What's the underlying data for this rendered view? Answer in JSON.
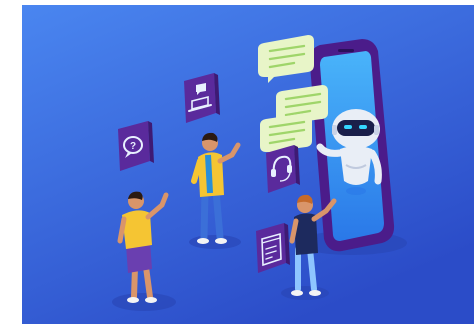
{
  "scene": {
    "kind": "isometric chatbot illustration",
    "colors": {
      "bg_light": "#4a86f0",
      "bg_dark": "#2b4cc8",
      "phone_frame": "#4b1c8a",
      "phone_screen": "#3aa0f5",
      "bubble": "#e8f5c8",
      "robot_body": "#e9eef6",
      "robot_visor": "#1a1f4a",
      "robot_eyes": "#35d6ff",
      "icon_tile": "#5a2a9c",
      "skin": "#d9956a",
      "shirt_yellow": "#f5c533",
      "pants_purple": "#6a3fb0",
      "jeans": "#3b6fd8"
    },
    "icons": [
      "help-speech-icon",
      "laptop-chat-icon",
      "headset-icon",
      "browser-chat-icon"
    ]
  }
}
